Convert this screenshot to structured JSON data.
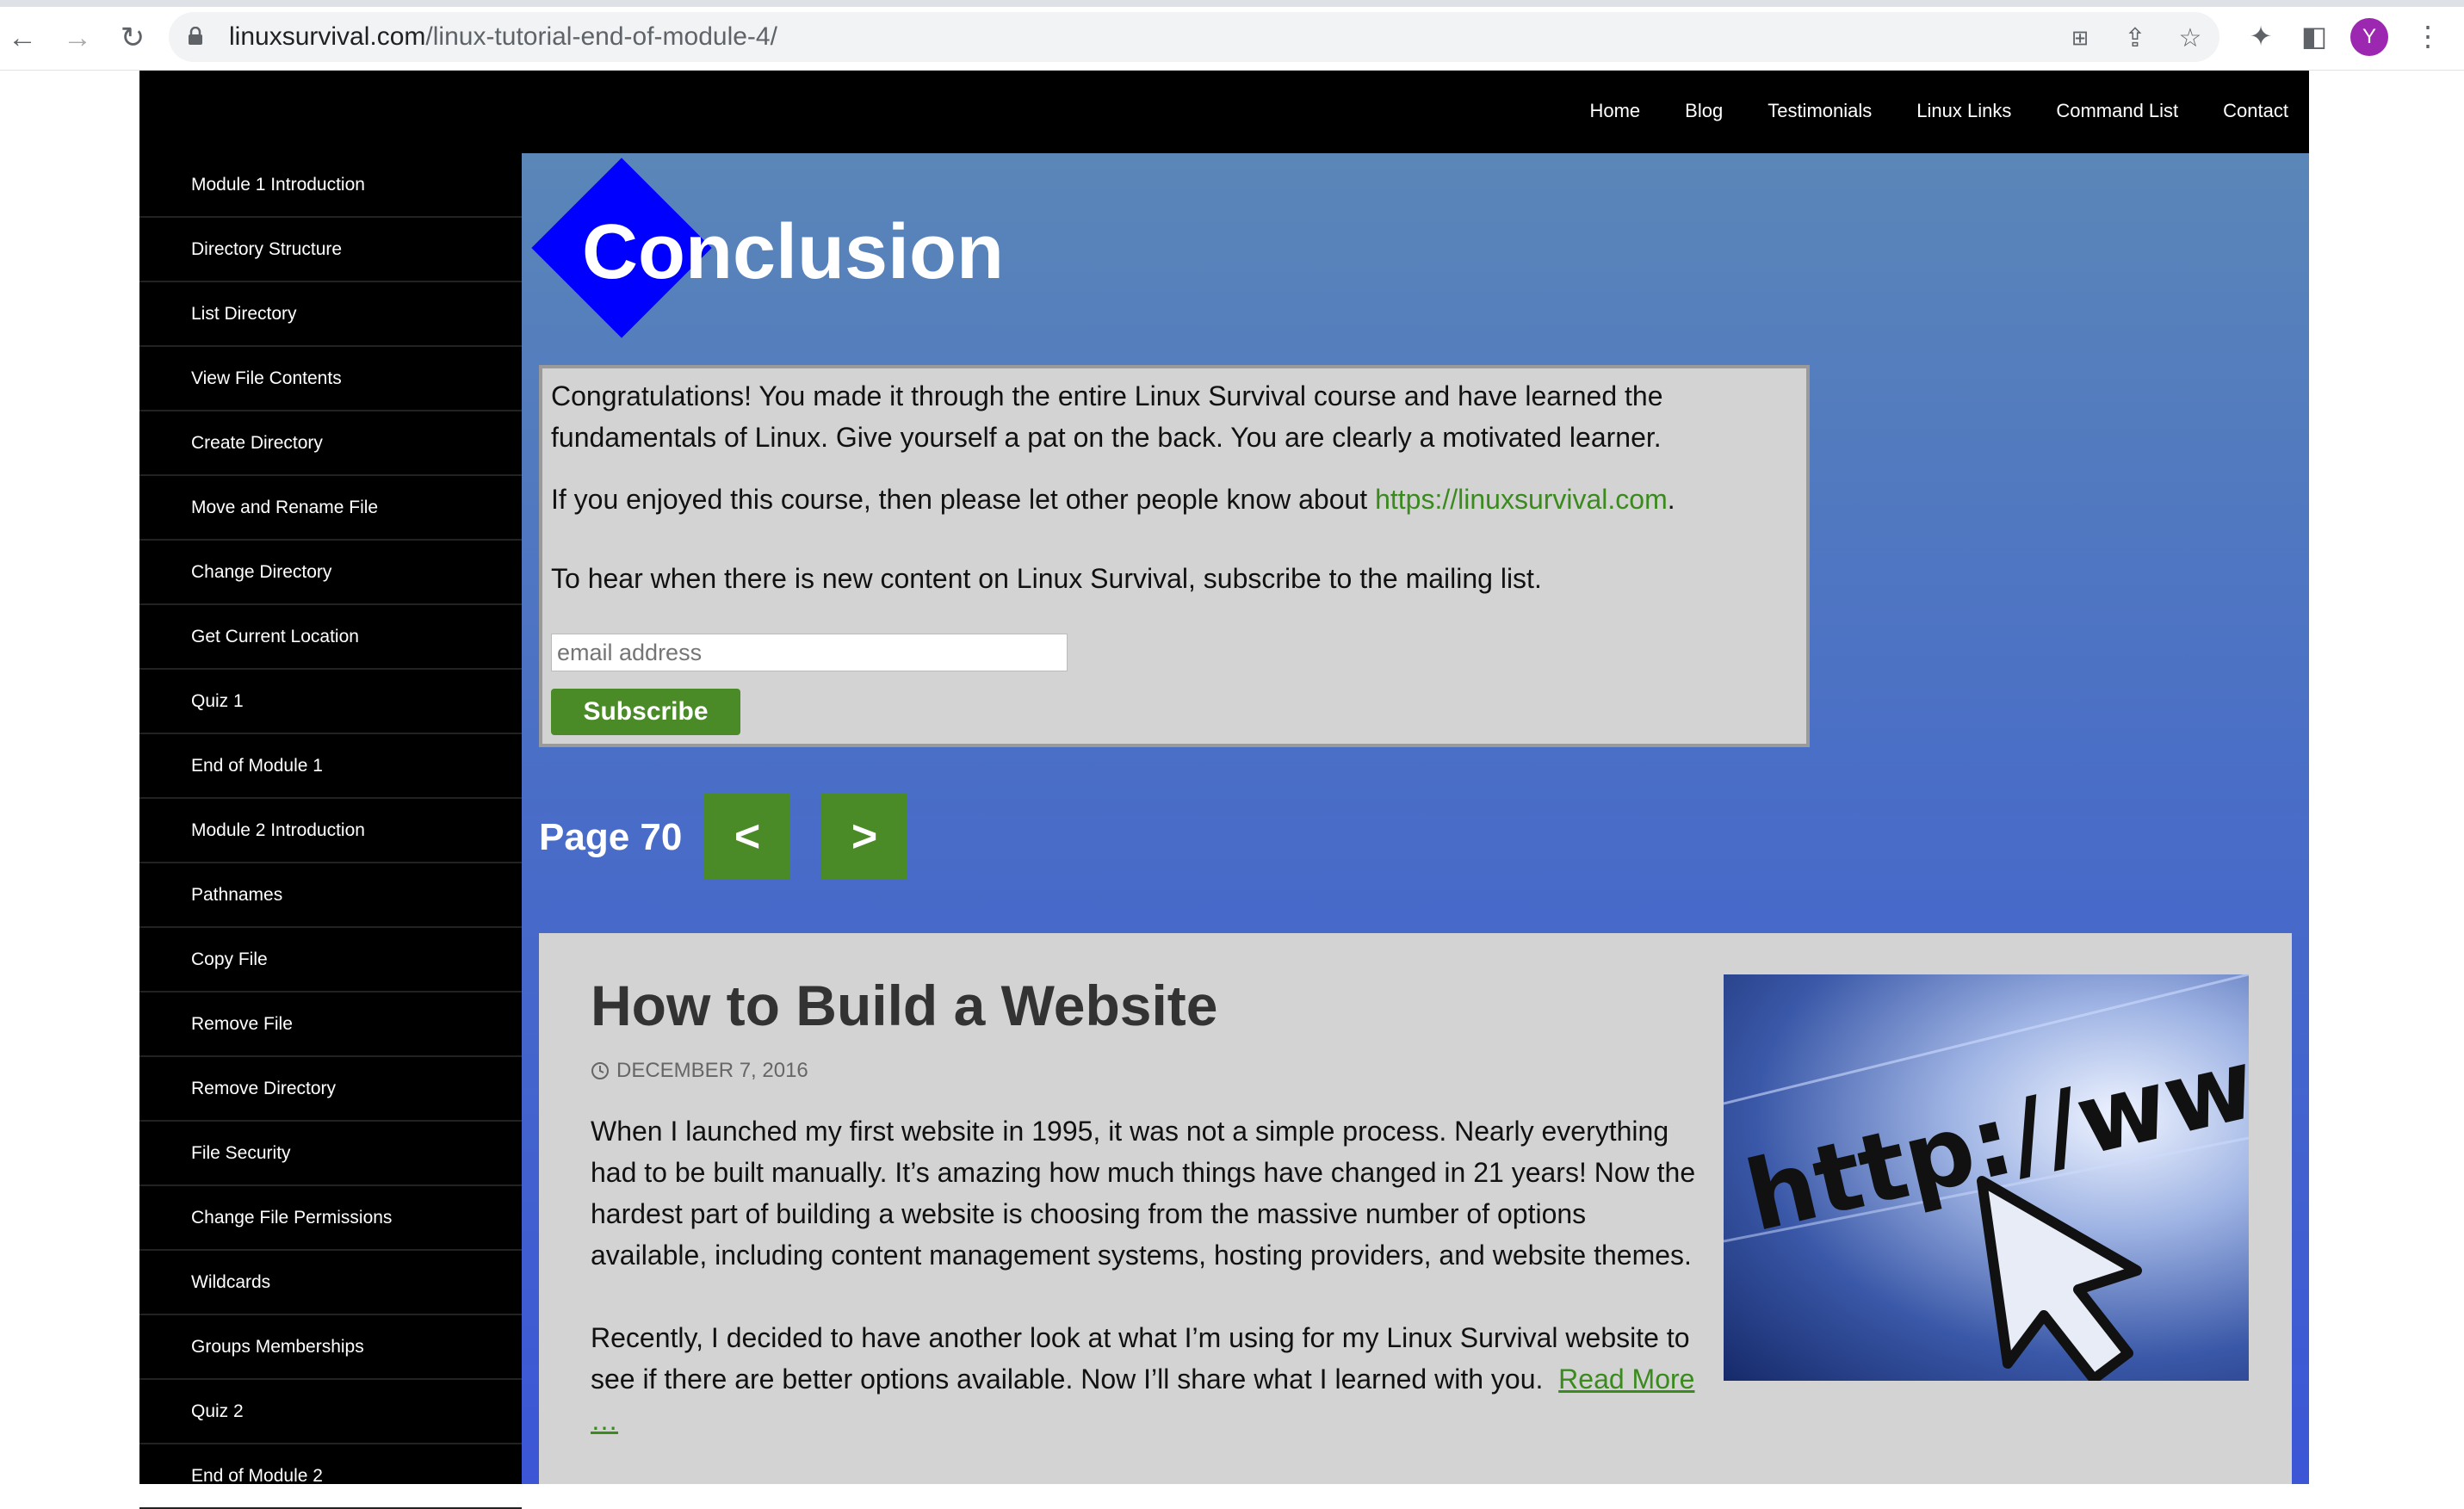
{
  "browser": {
    "url_domain": "linuxsurvival.com",
    "url_path": "/linux-tutorial-end-of-module-4/",
    "avatar_initial": "Y"
  },
  "topnav": [
    "Home",
    "Blog",
    "Testimonials",
    "Linux Links",
    "Command List",
    "Contact"
  ],
  "sidebar": [
    "Module 1 Introduction",
    "Directory Structure",
    "List Directory",
    "View File Contents",
    "Create Directory",
    "Move and Rename File",
    "Change Directory",
    "Get Current Location",
    "Quiz 1",
    "End of Module 1",
    "Module 2 Introduction",
    "Pathnames",
    "Copy File",
    "Remove File",
    "Remove Directory",
    "File Security",
    "Change File Permissions",
    "Wildcards",
    "Groups Memberships",
    "Quiz 2",
    "End of Module 2"
  ],
  "main": {
    "heading": "Conclusion",
    "congrats_text": "Congratulations! You made it through the entire Linux Survival course and have learned the fundamentals of Linux. Give yourself a pat on the back. You are clearly a motivated learner.",
    "share_prefix": "If you enjoyed this course, then please let other people know about ",
    "share_link": "https://linuxsurvival.com",
    "share_suffix": ".",
    "mailing_text": "To hear when there is new content on Linux Survival, subscribe to the mailing list.",
    "email_placeholder": "email address",
    "subscribe_label": "Subscribe",
    "page_label": "Page 70",
    "prev_label": "<",
    "next_label": ">"
  },
  "post": {
    "title": "How to Build a Website",
    "date": "DECEMBER 7, 2016",
    "p1": "When I launched my first website in 1995, it was not a simple process. Nearly everything had to be built manually. It’s amazing how much things have changed in 21 years! Now the hardest part of building a website is choosing from the massive number of options available, including content management systems, hosting providers, and website themes.",
    "p2": "Recently, I decided to have another look at what I’m using for my Linux Survival website to see if there are better options available. Now I’ll share what I learned with you.",
    "read_more": "Read More …",
    "image_text": "http://www"
  },
  "colors": {
    "accent_green": "#4a8a27",
    "diamond_blue": "#0000ff",
    "avatar_purple": "#9c27b0"
  }
}
